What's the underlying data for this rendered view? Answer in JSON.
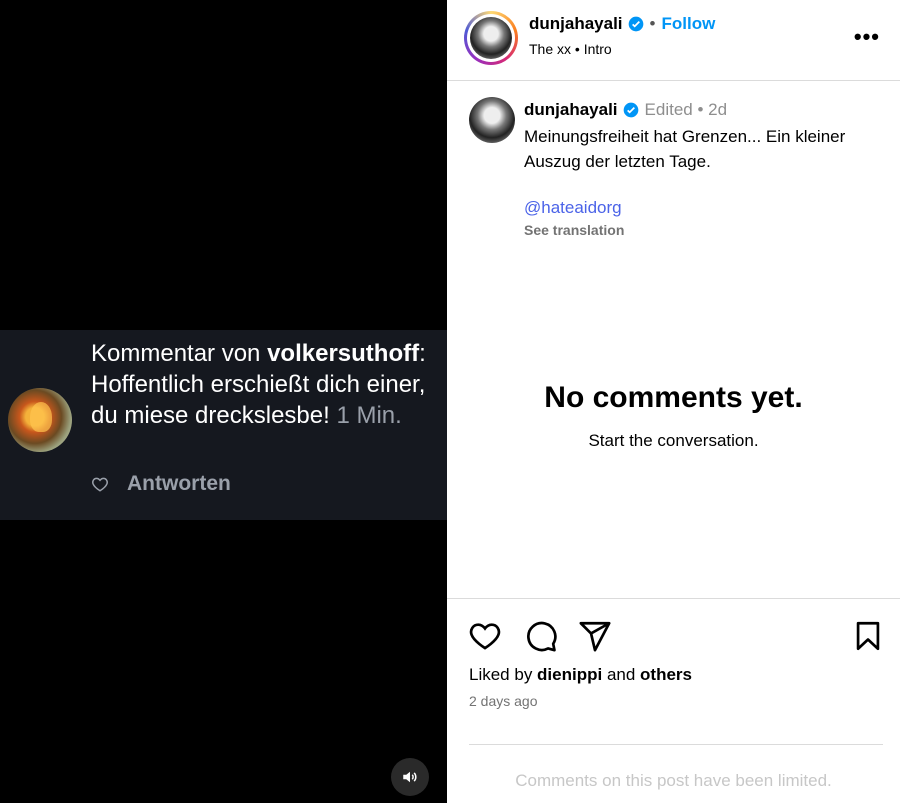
{
  "overlay": {
    "prefix": "Kommentar von ",
    "username": "volkersuthoff",
    "comment": ": Hoffentlich erschießt dich einer, du miese dreckslesbe!",
    "time": "1 Min.",
    "reply_label": "Antworten"
  },
  "header": {
    "username": "dunjahayali",
    "dot": "•",
    "follow_label": "Follow",
    "audio": "The xx • Intro",
    "more": "•••"
  },
  "caption": {
    "username": "dunjahayali",
    "meta": "Edited • 2d",
    "text": "Meinungsfreiheit hat Grenzen... Ein kleiner Auszug der letzten Tage.",
    "mention": "@hateaidorg",
    "see_translation": "See translation"
  },
  "comments": {
    "empty_title": "No comments yet.",
    "empty_subtitle": "Start the conversation."
  },
  "footer": {
    "liked_prefix": "Liked by ",
    "liked_user": "dienippi",
    "liked_mid": " and ",
    "liked_others": "others",
    "posted_ago": "2 days ago",
    "limited_notice": "Comments on this post have been limited."
  },
  "colors": {
    "accent": "#0095f6",
    "mention": "#4b63e8",
    "overlay_bg": "#15181f"
  }
}
